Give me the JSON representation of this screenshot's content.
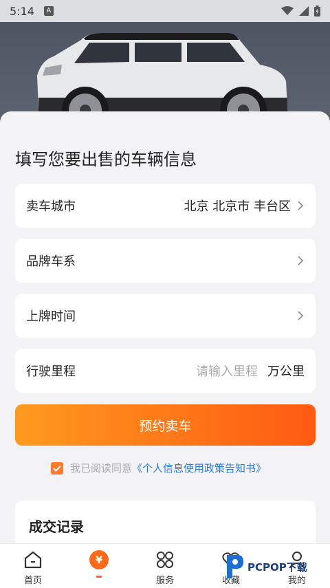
{
  "status": {
    "time": "5:14",
    "notif_letter": "A"
  },
  "page": {
    "title": "填写您要出售的车辆信息"
  },
  "form": {
    "city": {
      "label": "卖车城市",
      "value": "北京 北京市 丰台区"
    },
    "brand": {
      "label": "品牌车系"
    },
    "plate_time": {
      "label": "上牌时间"
    },
    "mileage": {
      "label": "行驶里程",
      "placeholder": "请输入里程",
      "unit": "万公里"
    }
  },
  "submit_label": "预约卖车",
  "agreement": {
    "prefix": "我已阅读同意",
    "link": "《个人信息使用政策告知书》",
    "checked": true
  },
  "records": {
    "title": "成交记录"
  },
  "tabs": [
    {
      "label": "首页",
      "icon": "home-icon"
    },
    {
      "label": "",
      "icon": "yen-coin-icon",
      "active": true
    },
    {
      "label": "服务",
      "icon": "grid-services-icon"
    },
    {
      "label": "收藏",
      "icon": "heart-icon"
    },
    {
      "label": "我的",
      "icon": "user-icon"
    }
  ],
  "watermark": {
    "text": "PCPOP下载"
  },
  "colors": {
    "accent": "#ff6a1a",
    "link": "#2d7bd6",
    "gradient_start": "#ff9a1f",
    "gradient_end": "#ff5a12"
  }
}
